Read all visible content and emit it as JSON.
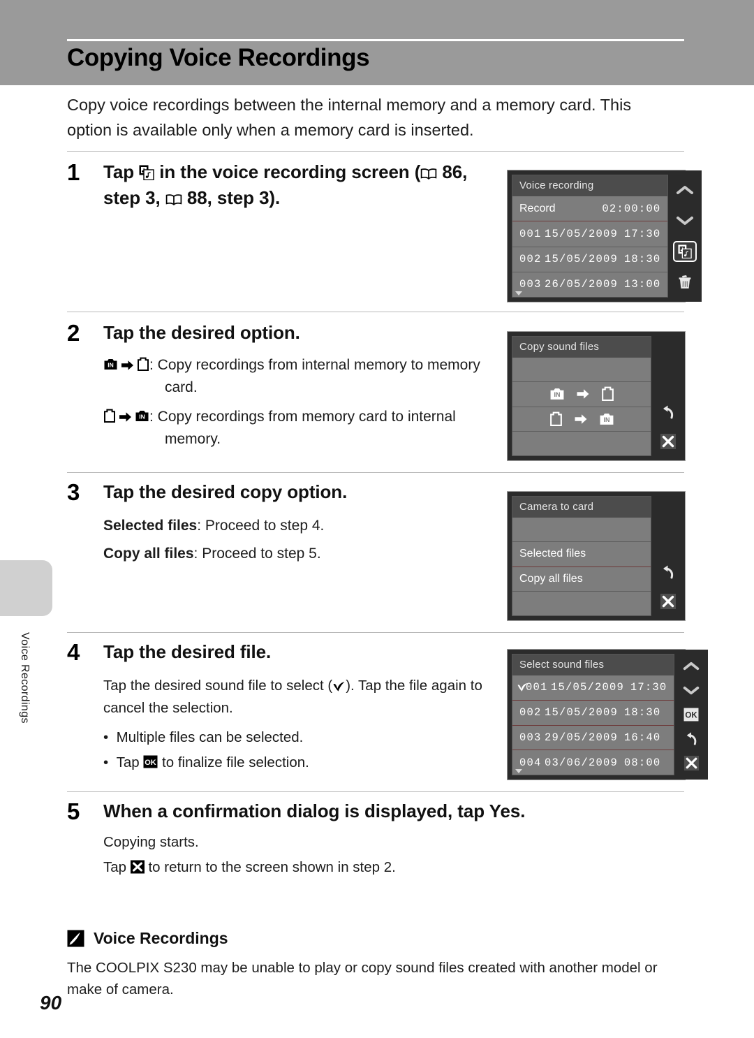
{
  "header": {
    "title": "Copying Voice Recordings"
  },
  "side": {
    "vertical_label": "Voice Recordings"
  },
  "intro": "Copy voice recordings between the internal memory and a memory card. This option is available only when a memory card is inserted.",
  "steps": [
    {
      "number": "1",
      "heading_before_icon": "Tap ",
      "heading_after_icon_a": " in the voice recording screen (",
      "heading_page_a": " 86,",
      "heading_line2_before": "step 3, ",
      "heading_page_b": " 88, step 3)."
    },
    {
      "number": "2",
      "heading": "Tap the desired option.",
      "option1_text": ": Copy recordings from internal memory to memory card.",
      "option2_text": ": Copy recordings from memory card to internal memory."
    },
    {
      "number": "3",
      "heading": "Tap the desired copy option.",
      "line1_bold": "Selected files",
      "line1_rest": ": Proceed to step 4.",
      "line2_bold": "Copy all files",
      "line2_rest": ": Proceed to step 5."
    },
    {
      "number": "4",
      "heading": "Tap the desired file.",
      "para_part1": "Tap the desired sound file to select (",
      "para_part2": "). Tap the file again to cancel the selection.",
      "bullet1": "Multiple files can be selected.",
      "bullet2_before": "Tap ",
      "bullet2_after": " to finalize file selection."
    },
    {
      "number": "5",
      "heading_before_bold": "When a confirmation dialog is displayed, tap ",
      "heading_bold": "Yes",
      "heading_after_bold": ".",
      "line1": "Copying starts.",
      "line2_before": "Tap ",
      "line2_after": " to return to the screen shown in step 2."
    }
  ],
  "screens": {
    "voice_recording": {
      "title": "Voice recording",
      "record_label": "Record",
      "record_time": "02:00:00",
      "files": [
        {
          "no": "001",
          "date": "15/05/2009",
          "time": "17:30"
        },
        {
          "no": "002",
          "date": "15/05/2009",
          "time": "18:30"
        },
        {
          "no": "003",
          "date": "26/05/2009",
          "time": "13:00"
        }
      ],
      "buttons": [
        "up-chevron-icon",
        "down-chevron-icon",
        "copy-sound-files-icon",
        "delete-icon"
      ]
    },
    "copy_sound_files": {
      "title": "Copy sound files",
      "option_internal_to_card": "internal-to-card",
      "option_card_to_internal": "card-to-internal",
      "buttons": [
        "back-icon",
        "close-icon"
      ]
    },
    "camera_to_card": {
      "title": "Camera to card",
      "items": [
        "Selected files",
        "Copy all files"
      ],
      "buttons": [
        "back-icon",
        "close-icon"
      ]
    },
    "select_sound_files": {
      "title": "Select sound files",
      "files": [
        {
          "no": "001",
          "date": "15/05/2009",
          "time": "17:30",
          "selected": true
        },
        {
          "no": "002",
          "date": "15/05/2009",
          "time": "18:30",
          "selected": false
        },
        {
          "no": "003",
          "date": "29/05/2009",
          "time": "16:40",
          "selected": false
        },
        {
          "no": "004",
          "date": "03/06/2009",
          "time": "08:00",
          "selected": false
        }
      ],
      "buttons": [
        "up-chevron-icon",
        "down-chevron-icon",
        "ok-icon",
        "back-icon",
        "close-icon"
      ]
    }
  },
  "note": {
    "title": "Voice Recordings",
    "body": "The COOLPIX S230 may be unable to play or copy sound files created with another model or make of camera."
  },
  "page_number": "90",
  "colors": {
    "header_band": "#9a9a9a",
    "screen_body": "#7d7d7d",
    "screen_bezel": "#2b2b2b",
    "divider_red": "#6d3a3a"
  }
}
